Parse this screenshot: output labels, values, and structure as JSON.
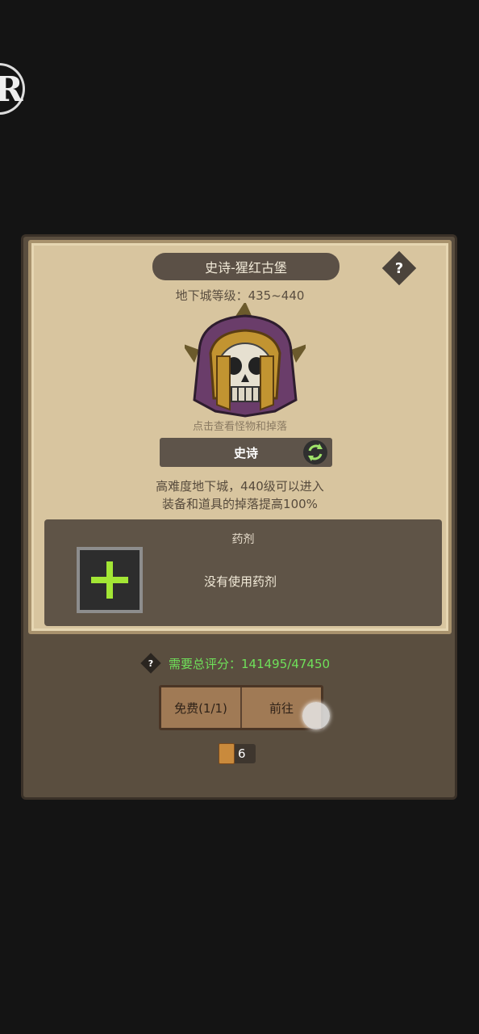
{
  "dungeon": {
    "title": "史诗-猩红古堡",
    "level_text": "地下城等级：435~440",
    "boss_hint": "点击查看怪物和掉落",
    "difficulty": "史诗",
    "desc_line1": "高难度地下城，440级可以进入",
    "desc_line2": "装备和道具的掉落提高100%"
  },
  "potion": {
    "title": "药剂",
    "empty_text": "没有使用药剂"
  },
  "requirement": {
    "text": "需要总评分：141495/47450"
  },
  "buttons": {
    "free": "免费(1/1)",
    "go": "前往"
  },
  "scroll": {
    "count": "6"
  },
  "corner_glyph": "R",
  "help_glyph": "?"
}
